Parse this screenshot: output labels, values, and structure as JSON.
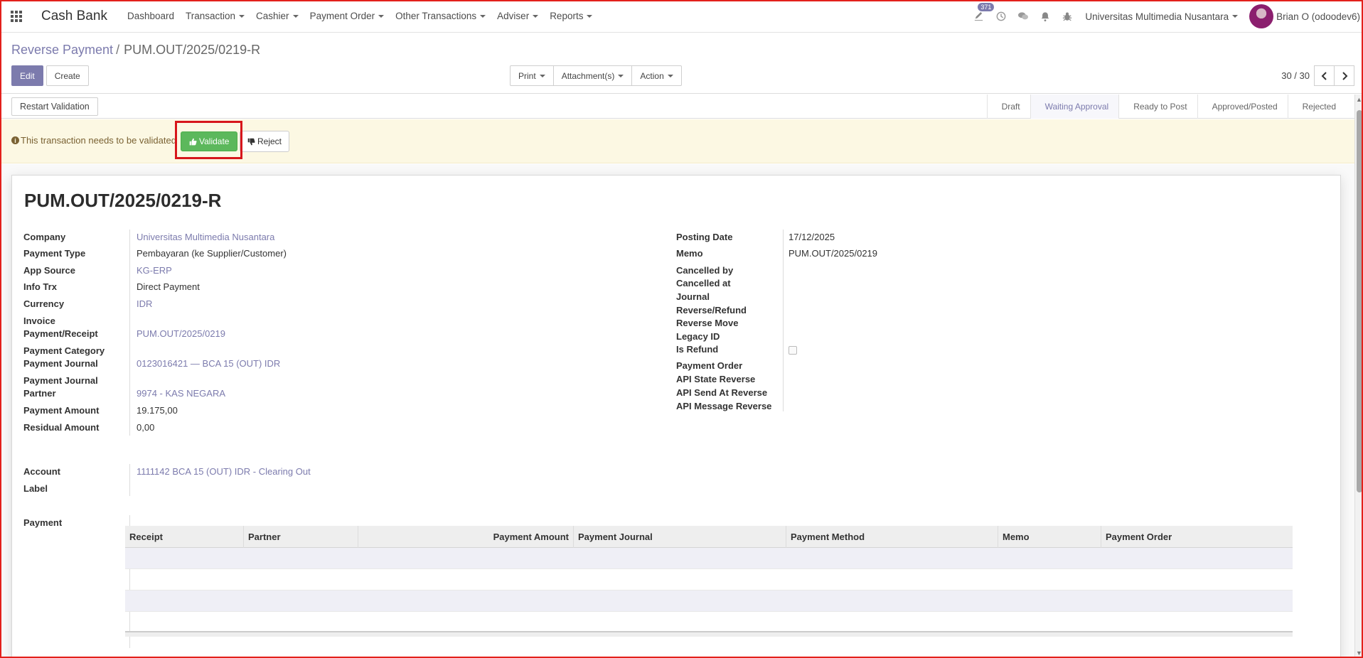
{
  "navbar": {
    "app_title": "Cash Bank",
    "menu": [
      {
        "label": "Dashboard",
        "dropdown": false
      },
      {
        "label": "Transaction",
        "dropdown": true
      },
      {
        "label": "Cashier",
        "dropdown": true
      },
      {
        "label": "Payment Order",
        "dropdown": true
      },
      {
        "label": "Other Transactions",
        "dropdown": true
      },
      {
        "label": "Adviser",
        "dropdown": true
      },
      {
        "label": "Reports",
        "dropdown": true
      }
    ],
    "activity_badge": "371",
    "company": "Universitas Multimedia Nusantara",
    "user": "Brian O (odoodev6)"
  },
  "breadcrumb": {
    "parent": "Reverse Payment",
    "separator": "/",
    "current": "PUM.OUT/2025/0219-R"
  },
  "buttons": {
    "edit": "Edit",
    "create": "Create",
    "print": "Print",
    "attachments": "Attachment(s)",
    "action": "Action"
  },
  "pager": {
    "value": "30 / 30"
  },
  "statusbar": {
    "restart_label": "Restart Validation",
    "stages": [
      "Draft",
      "Waiting Approval",
      "Ready to Post",
      "Approved/Posted",
      "Rejected"
    ],
    "active_stage": "Waiting Approval"
  },
  "alert": {
    "message": "This transaction needs to be validated",
    "validate_label": "Validate",
    "reject_label": "Reject"
  },
  "record": {
    "title": "PUM.OUT/2025/0219-R",
    "left": {
      "company_label": "Company",
      "company_value": "Universitas Multimedia Nusantara",
      "payment_type_label": "Payment Type",
      "payment_type_value": "Pembayaran (ke Supplier/Customer)",
      "app_source_label": "App Source",
      "app_source_value": "KG-ERP",
      "info_trx_label": "Info Trx",
      "info_trx_value": "Direct Payment",
      "currency_label": "Currency",
      "currency_value": "IDR",
      "invoice_label": "Invoice",
      "payment_receipt_label": "Payment/Receipt",
      "payment_receipt_value": "PUM.OUT/2025/0219",
      "payment_category_label": "Payment Category",
      "payment_journal_label": "Payment Journal",
      "payment_journal_value": "0123016421 — BCA 15 (OUT) IDR",
      "payment_journal_partner_label_1": "Payment Journal",
      "payment_journal_partner_label_2": "Partner",
      "payment_journal_partner_value": "9974 - KAS NEGARA",
      "payment_amount_label": "Payment Amount",
      "payment_amount_value": "19.175,00",
      "residual_amount_label": "Residual Amount",
      "residual_amount_value": "0,00",
      "account_label": "Account",
      "account_value": "1111142 BCA 15 (OUT) IDR - Clearing Out",
      "label_label": "Label",
      "payment_label": "Payment"
    },
    "right": {
      "posting_date_label": "Posting Date",
      "posting_date_value": "17/12/2025",
      "memo_label": "Memo",
      "memo_value": "PUM.OUT/2025/0219",
      "cancelled_by_label": "Cancelled by",
      "cancelled_at_label": "Cancelled at",
      "journal_label": "Journal",
      "reverse_refund_label": "Reverse/Refund",
      "reverse_move_label": "Reverse Move",
      "legacy_id_label": "Legacy ID",
      "is_refund_label": "Is Refund",
      "is_refund_value": false,
      "payment_order_label": "Payment Order",
      "api_state_reverse_label": "API State Reverse",
      "api_send_at_reverse_label": "API Send At Reverse",
      "api_message_reverse_label": "API Message Reverse"
    }
  },
  "payment_table": {
    "columns": [
      "Receipt",
      "Partner",
      "Payment Amount",
      "Payment Journal",
      "Payment Method",
      "Memo",
      "Payment Order"
    ],
    "rows": []
  },
  "colors": {
    "brand": "#7c7bad",
    "validate": "#5cb85c",
    "alert_bg": "#fcf8e3",
    "highlight": "#d7161b"
  }
}
